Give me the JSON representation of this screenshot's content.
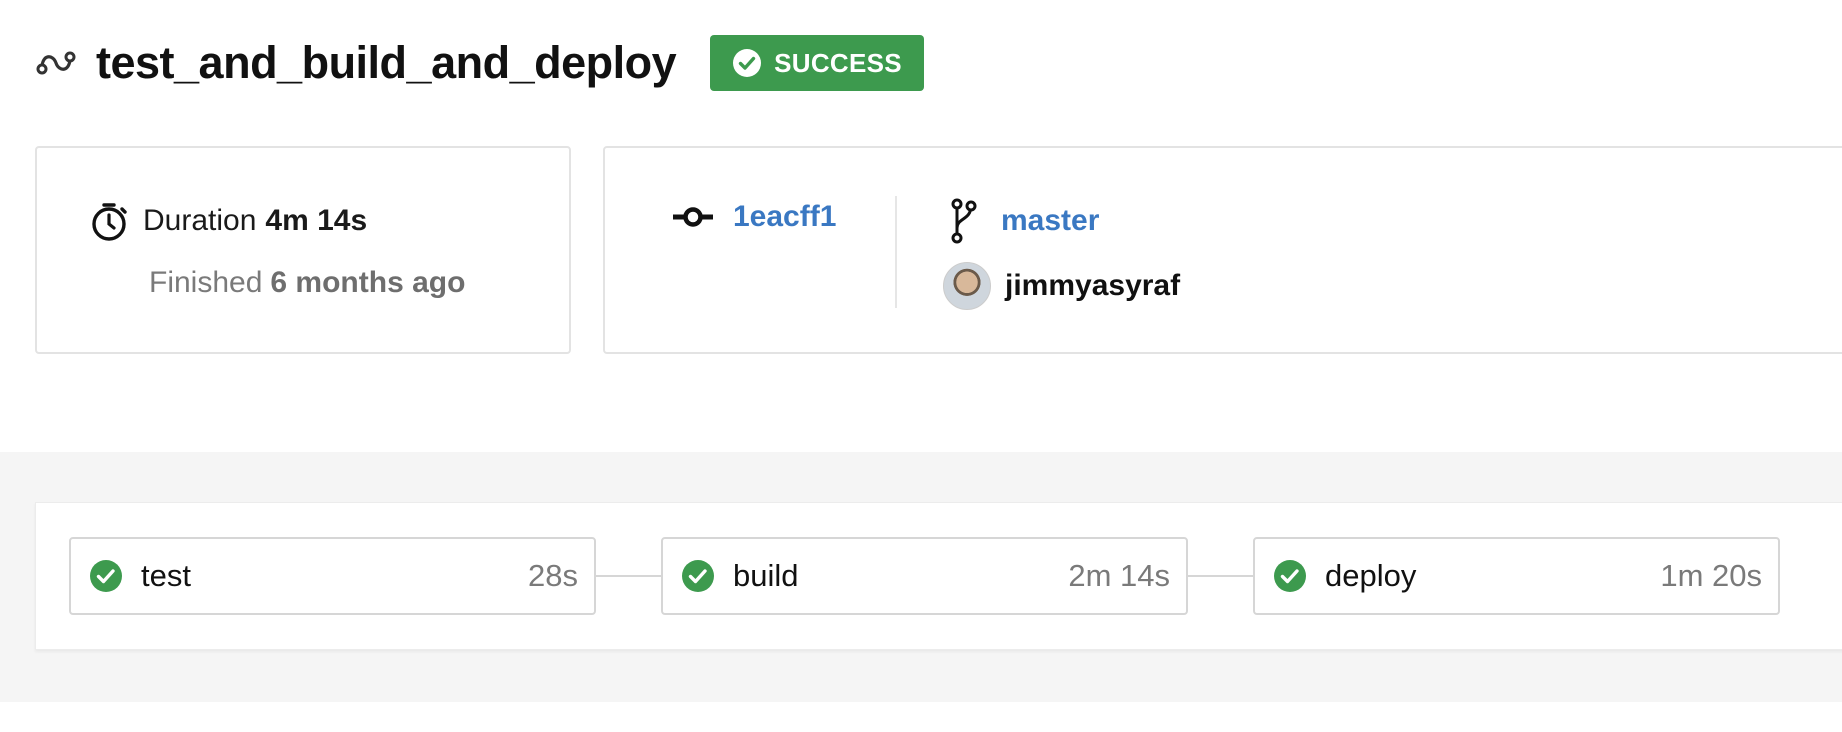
{
  "pipeline": {
    "name": "test_and_build_and_deploy",
    "status": "SUCCESS",
    "status_color": "#3d9a4e"
  },
  "summary": {
    "duration_label": "Duration",
    "duration_value": "4m 14s",
    "finished_label": "Finished",
    "finished_value": "6 months ago"
  },
  "commit": {
    "hash": "1eacff1",
    "branch": "master",
    "author": "jimmyasyraf",
    "link_color": "#3a78c2"
  },
  "stages": [
    {
      "name": "test",
      "duration": "28s"
    },
    {
      "name": "build",
      "duration": "2m 14s"
    },
    {
      "name": "deploy",
      "duration": "1m 20s"
    }
  ],
  "icons": {
    "pipeline": "pipeline-icon",
    "status": "check-circle-icon",
    "duration": "stopwatch-icon",
    "commit": "commit-icon",
    "branch": "branch-icon"
  }
}
